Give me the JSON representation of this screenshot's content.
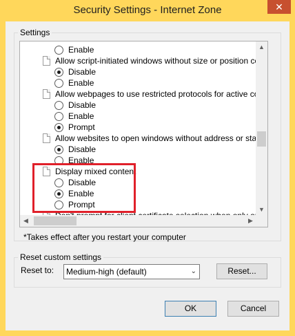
{
  "window": {
    "title": "Security Settings - Internet Zone",
    "close_glyph": "✕"
  },
  "settings_group": {
    "label": "Settings",
    "rows": [
      {
        "kind": "option",
        "label": "Enable",
        "checked": false
      },
      {
        "kind": "header",
        "label": "Allow script-initiated windows without size or position constra"
      },
      {
        "kind": "option",
        "label": "Disable",
        "checked": true
      },
      {
        "kind": "option",
        "label": "Enable",
        "checked": false
      },
      {
        "kind": "header",
        "label": "Allow webpages to use restricted protocols for active conten"
      },
      {
        "kind": "option",
        "label": "Disable",
        "checked": false
      },
      {
        "kind": "option",
        "label": "Enable",
        "checked": false
      },
      {
        "kind": "option",
        "label": "Prompt",
        "checked": true
      },
      {
        "kind": "header",
        "label": "Allow websites to open windows without address or status ba"
      },
      {
        "kind": "option",
        "label": "Disable",
        "checked": true
      },
      {
        "kind": "option",
        "label": "Enable",
        "checked": false
      },
      {
        "kind": "header",
        "label": "Display mixed content"
      },
      {
        "kind": "option",
        "label": "Disable",
        "checked": false
      },
      {
        "kind": "option",
        "label": "Enable",
        "checked": true
      },
      {
        "kind": "option",
        "label": "Prompt",
        "checked": false
      },
      {
        "kind": "header",
        "label": "Don't prompt for client certificate selection when only one ce"
      }
    ]
  },
  "note": "*Takes effect after you restart your computer",
  "reset_group": {
    "label": "Reset custom settings",
    "reset_to_label": "Reset to:",
    "reset_select_value": "Medium-high (default)",
    "reset_button": "Reset..."
  },
  "footer": {
    "ok_label": "OK",
    "cancel_label": "Cancel"
  },
  "colors": {
    "title_bar": "#ffd75b",
    "close_button": "#c7502f",
    "highlight": "#e0202a"
  }
}
